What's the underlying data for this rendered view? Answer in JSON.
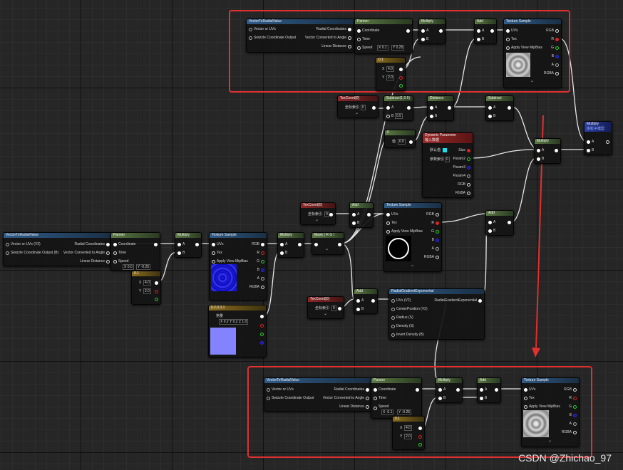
{
  "watermark": "CSDN @Zhichao_97",
  "nodes": {
    "vtr1": {
      "title": "VectorToRadialValue",
      "in": [
        "Vector or UVs",
        "Swizzle Coordinate Output"
      ],
      "out": [
        "Radial Coordinates",
        "Vector Converted to Angle",
        "Linear Distance"
      ]
    },
    "pan1": {
      "title": "Panner",
      "in": [
        "Coordinate",
        "Time",
        "Speed"
      ],
      "speed_x": "0.1",
      "speed_y": "0.25"
    },
    "mul1": {
      "title": "Multiply",
      "in": [
        "A",
        "B"
      ]
    },
    "add1": {
      "title": "Add",
      "in": [
        "A",
        "B"
      ]
    },
    "ts1": {
      "title": "Texture Sample",
      "in": [
        "UVs",
        "Tex",
        "Apply View MipBias"
      ],
      "out": [
        "RGB",
        "R",
        "G",
        "B",
        "A",
        "RGBA"
      ]
    },
    "c2a": {
      "title": "0.1",
      "x": "X",
      "xv": "4.0",
      "y": "Y",
      "yv": "2.0"
    },
    "texc1": {
      "title": "TexCoord[0]",
      "param": "坐标索引",
      "val": "0"
    },
    "sub1": {
      "title": "Subtract(1,0.5)",
      "a": "A",
      "b": "B",
      "bv": "0.5"
    },
    "dist1": {
      "title": "Distance",
      "a": "A",
      "b": "B"
    },
    "sub2": {
      "title": "Subtract",
      "a": "A",
      "b": "B"
    },
    "const0": {
      "title": "0",
      "param": "值",
      "val": "0.0"
    },
    "dynp": {
      "title": "Dynamic Parameter",
      "subtitle": "输入数据",
      "default": "默认值",
      "idx": "参数索引",
      "idxv": "0",
      "pins": [
        "Size",
        "Param2",
        "Param3",
        "Param4",
        "RGB",
        "RGBA"
      ]
    },
    "mul2": {
      "title": "Multiply",
      "a": "A",
      "b": "B"
    },
    "mul3": {
      "title": "Multiply",
      "subtitle": "多粒子模型",
      "a": "A",
      "b": "B"
    },
    "vtr2": {
      "title": "VectorToRadialValue",
      "in": [
        "Vector or UVs (V2)",
        "Swizzle Coordinate Output (B)"
      ],
      "out": [
        "Radial Coordinates",
        "Vector Converted to Angle",
        "Linear Distance"
      ]
    },
    "pan2": {
      "title": "Panner",
      "in": [
        "Coordinate",
        "Time",
        "Speed"
      ],
      "speed_x": "0.0",
      "speed_y": "-0.25"
    },
    "c2b": {
      "title": "0.1",
      "x": "X",
      "xv": "4.0",
      "y": "Y",
      "yv": "2.0"
    },
    "mul4": {
      "title": "Multiply",
      "a": "A",
      "b": "B"
    },
    "ts2": {
      "title": "Texture Sample",
      "in": [
        "UVs",
        "Tex",
        "Apply View MipBias"
      ],
      "out": [
        "RGB",
        "R",
        "G",
        "B",
        "A",
        "RGBA"
      ]
    },
    "c3": {
      "title": "0.2,0.3,1",
      "param": "常量",
      "vals": "X 0.2  Y 0.2  Z 1.0"
    },
    "mul5": {
      "title": "Multiply",
      "a": "A",
      "b": "B"
    },
    "mask": {
      "title": "Mask ( R G )"
    },
    "texc2": {
      "title": "TexCoord[0]",
      "param": "坐标索引",
      "val": "0"
    },
    "add2": {
      "title": "Add",
      "a": "A",
      "b": "B"
    },
    "ts3": {
      "title": "Texture Sample",
      "in": [
        "UVs",
        "Tex",
        "Apply View MipBias"
      ],
      "out": [
        "RGB",
        "R",
        "G",
        "B",
        "A",
        "RGBA"
      ]
    },
    "add3": {
      "title": "Add",
      "a": "A",
      "b": "B"
    },
    "texc3": {
      "title": "TexCoord[0]",
      "param": "坐标索引",
      "val": "0"
    },
    "add4": {
      "title": "Add",
      "a": "A",
      "b": "B"
    },
    "rge": {
      "title": "RadialGradientExponential",
      "in": [
        "UVs (V2)",
        "CenterPosition (V2)",
        "Radius (S)",
        "Density (S)",
        "Invert Density (B)"
      ],
      "out": "RadialGradientExponential"
    },
    "vtr3": {
      "title": "VectorToRadialValue",
      "in": [
        "Vector or UVs",
        "Swizzle Coordinate Output"
      ],
      "out": [
        "Radial Coordinates",
        "Vector Converted to Angle",
        "Linear Distance"
      ]
    },
    "pan3": {
      "title": "Panner",
      "in": [
        "Coordinate",
        "Time",
        "Speed"
      ],
      "speed_x": "-0.1",
      "speed_y": "-0.25"
    },
    "c2c": {
      "title": "0.1",
      "x": "X",
      "xv": "4.0",
      "y": "Y",
      "yv": "2.0"
    },
    "mul6": {
      "title": "Multiply",
      "a": "A",
      "b": "B"
    },
    "add5": {
      "title": "Add",
      "a": "A",
      "b": "B"
    },
    "ts4": {
      "title": "Texture Sample",
      "in": [
        "UVs",
        "Tex",
        "Apply View MipBias"
      ],
      "out": [
        "RGB",
        "R",
        "G",
        "B",
        "A",
        "RGBA"
      ]
    }
  },
  "colors": {
    "frame": "#e03030",
    "canvas": "#262626"
  }
}
